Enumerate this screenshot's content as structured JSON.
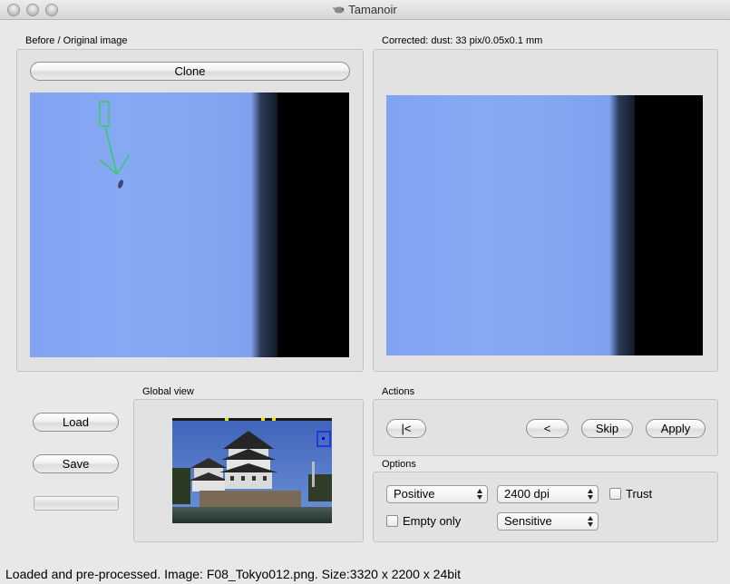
{
  "window": {
    "title": "Tamanoir"
  },
  "before_panel": {
    "label": "Before / Original image",
    "clone_label": "Clone"
  },
  "corrected_panel": {
    "label": "Corrected: dust: 33 pix/0.05x0.1 mm"
  },
  "global_view": {
    "label": "Global view"
  },
  "left_buttons": {
    "load_label": "Load",
    "save_label": "Save"
  },
  "actions": {
    "label": "Actions",
    "first_label": "|<",
    "prev_label": "<",
    "skip_label": "Skip",
    "apply_label": "Apply"
  },
  "options": {
    "label": "Options",
    "mode_value": "Positive",
    "dpi_value": "2400 dpi",
    "sensitivity_value": "Sensitive",
    "trust_label": "Trust",
    "trust_checked": false,
    "empty_only_label": "Empty only",
    "empty_only_checked": false
  },
  "status": {
    "text": "Loaded and pre-processed. Image: F08_Tokyo012.png. Size:3320 x 2200 x 24bit"
  },
  "colors": {
    "image_blue": "#85a6f2",
    "marker_green": "#33cc66",
    "view_marker_blue": "#0000ff"
  },
  "icons": {
    "app_icon": "tamanoir-anteater-icon",
    "select_arrows": "up-down-arrows-icon"
  }
}
